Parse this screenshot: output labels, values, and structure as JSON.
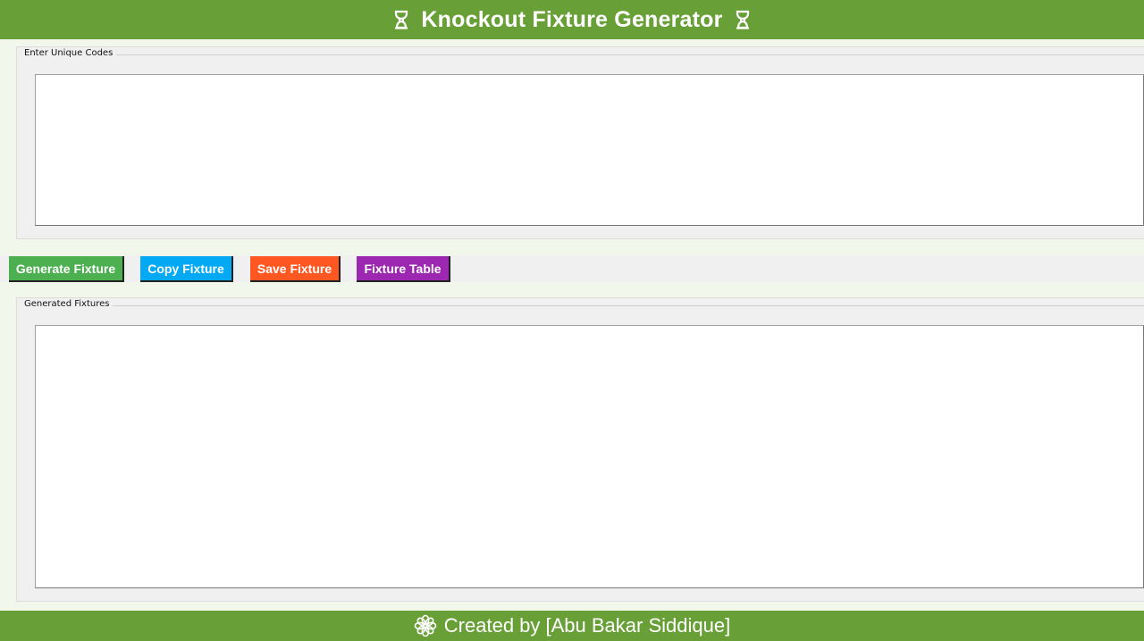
{
  "header": {
    "title": "Knockout Fixture Generator",
    "icon_left": "trophy-icon",
    "icon_right": "trophy-icon",
    "background": "#699f37"
  },
  "codes_group": {
    "legend": "Enter Unique Codes",
    "value": ""
  },
  "toolbar": {
    "generate_label": "Generate Fixture",
    "copy_label": "Copy Fixture",
    "save_label": "Save Fixture",
    "table_label": "Fixture Table",
    "colors": {
      "generate": "#4caf50",
      "copy": "#03a9f4",
      "save": "#ff5722",
      "table": "#9c27b0"
    }
  },
  "fixtures_group": {
    "legend": "Generated Fixtures",
    "value": ""
  },
  "footer": {
    "icon": "flower-icon",
    "credit": "Created by [Abu Bakar Siddique]",
    "background": "#699f37"
  }
}
